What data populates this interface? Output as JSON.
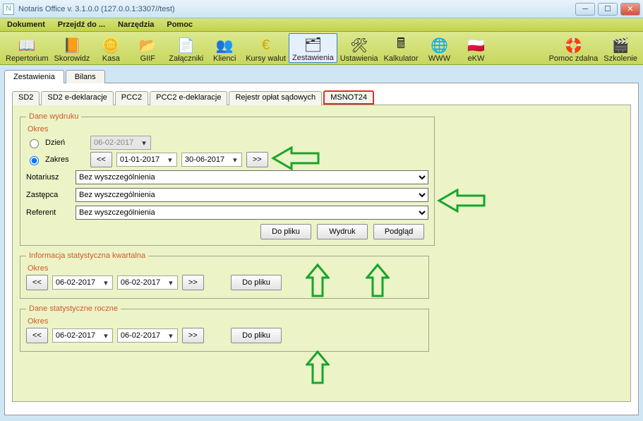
{
  "window": {
    "title": "Notaris Office v. 3.1.0.0 (127.0.0.1:3307//test)",
    "icon_letter": "N"
  },
  "menu": [
    "Dokument",
    "Przejdź do ...",
    "Narzędzia",
    "Pomoc"
  ],
  "toolbar": [
    {
      "key": "repertorium",
      "label": "Repertorium",
      "icon": "📖"
    },
    {
      "key": "skorowidz",
      "label": "Skorowidz",
      "icon": "📙"
    },
    {
      "key": "kasa",
      "label": "Kasa",
      "icon": "🪙"
    },
    {
      "key": "giif",
      "label": "GIIF",
      "icon": "📂"
    },
    {
      "key": "zalaczniki",
      "label": "Załączniki",
      "icon": "📄"
    },
    {
      "key": "klienci",
      "label": "Klienci",
      "icon": "👥"
    },
    {
      "key": "kursy",
      "label": "Kursy walut",
      "icon": "€"
    },
    {
      "key": "zestawienia",
      "label": "Zestawienia",
      "icon": "🗂",
      "selected": true
    },
    {
      "key": "ustawienia",
      "label": "Ustawienia",
      "icon": "🛠"
    },
    {
      "key": "kalkulator",
      "label": "Kalkulator",
      "icon": "🖩"
    },
    {
      "key": "www",
      "label": "WWW",
      "icon": "🌐"
    },
    {
      "key": "ekw",
      "label": "eKW",
      "icon": "🇵🇱"
    }
  ],
  "toolbar_right": [
    {
      "key": "pomoc",
      "label": "Pomoc zdalna",
      "icon": "🛟"
    },
    {
      "key": "szkolenie",
      "label": "Szkolenie",
      "icon": "🎬"
    }
  ],
  "main_tabs": [
    {
      "key": "zestawienia",
      "label": "Zestawienia",
      "active": true
    },
    {
      "key": "bilans",
      "label": "Bilans",
      "active": false
    }
  ],
  "sub_tabs": [
    "SD2",
    "SD2 e-deklaracje",
    "PCC2",
    "PCC2 e-deklaracje",
    "Rejestr opłat sądowych",
    "MSNOT24"
  ],
  "sub_tab_active": "MSNOT24",
  "dane_wydruku": {
    "legend": "Dane wydruku",
    "okres_label": "Okres",
    "radio_dzien": "Dzień",
    "radio_zakres": "Zakres",
    "dzien_value": "06-02-2017",
    "zakres_from": "01-01-2017",
    "zakres_to": "30-06-2017",
    "prev": "<<",
    "next": ">>",
    "notariusz_label": "Notariusz",
    "zastepca_label": "Zastępca",
    "referent_label": "Referent",
    "select_value": "Bez wyszczególnienia",
    "btn_doplik": "Do pliku",
    "btn_wydruk": "Wydruk",
    "btn_podglad": "Podgląd"
  },
  "kwartalna": {
    "legend": "Informacja statystyczna kwartalna",
    "okres_label": "Okres",
    "from": "06-02-2017",
    "to": "06-02-2017",
    "prev": "<<",
    "next": ">>",
    "btn": "Do pliku"
  },
  "roczne": {
    "legend": "Dane statystyczne roczne",
    "okres_label": "Okres",
    "from": "06-02-2017",
    "to": "06-02-2017",
    "prev": "<<",
    "next": ">>",
    "btn": "Do pliku"
  }
}
